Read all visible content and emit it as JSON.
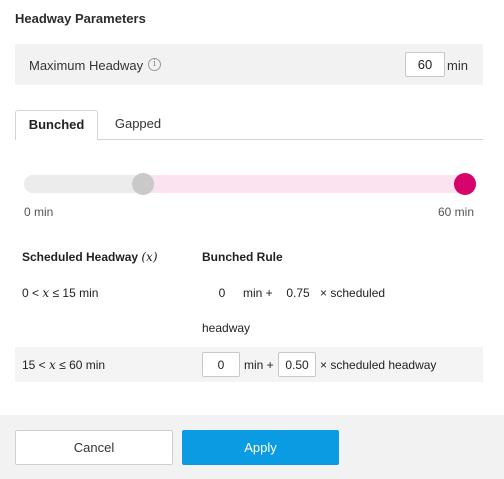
{
  "section_title": "Headway Parameters",
  "max_headway": {
    "label": "Maximum Headway",
    "info_icon": "i",
    "value": "60",
    "unit": "min"
  },
  "tabs": [
    {
      "label": "Bunched",
      "active": true
    },
    {
      "label": "Gapped",
      "active": false
    }
  ],
  "slider": {
    "min_label": "0 min",
    "max_label": "60 min",
    "range_min": 0,
    "range_max": 60,
    "low_value": 15,
    "high_value": 60,
    "track_color": "#ececec",
    "fill_color": "#fbe3ef",
    "low_handle_color": "#c9c9c9",
    "high_handle_color": "#d6046b"
  },
  "table": {
    "col1_header_text": "Scheduled Headway ",
    "col1_header_var": "(x)",
    "col2_header": "Bunched Rule",
    "rows": [
      {
        "range_prefix": "0 < ",
        "range_var": "x",
        "range_suffix": " ≤ 15 min",
        "value1": "0",
        "mid_text": "min +",
        "value2": "0.75",
        "tail_text": "× scheduled",
        "wrap_text": "headway"
      },
      {
        "range_prefix": "15 < ",
        "range_var": "x",
        "range_suffix": " ≤ 60 min",
        "value1": "0",
        "mid_text": "min +",
        "value2": "0.50",
        "tail_text": "× scheduled headway"
      }
    ]
  },
  "footer": {
    "cancel_label": "Cancel",
    "apply_label": "Apply",
    "apply_color": "#0b9be3"
  }
}
